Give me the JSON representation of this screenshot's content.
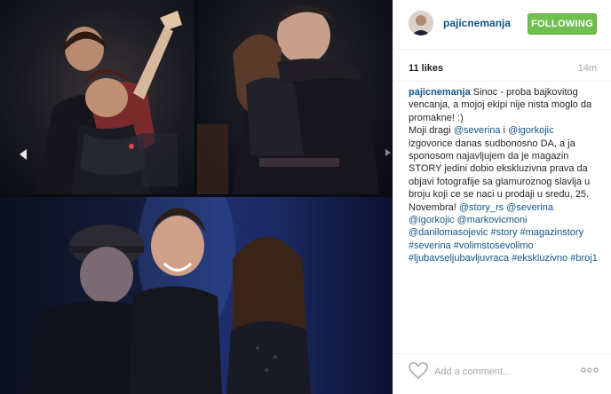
{
  "post": {
    "username": "pajicnemanja",
    "follow_label": "FOLLOWING",
    "likes": "11 likes",
    "time": "14m"
  },
  "caption": [
    {
      "t": "u",
      "v": "pajicnemanja"
    },
    {
      "t": "s",
      "v": " Sinoc - proba bajkovitog vencanja, a mojoj ekipi nije nista moglo da promakne! :)"
    },
    {
      "t": "br"
    },
    {
      "t": "s",
      "v": "Moji dragi "
    },
    {
      "t": "l",
      "v": "@severina"
    },
    {
      "t": "s",
      "v": " i "
    },
    {
      "t": "l",
      "v": "@igorkojic"
    },
    {
      "t": "s",
      "v": " izgovorice danas sudbonosno DA, a ja sponosom najavljujem da je magazin STORY jedini dobio ekskluzivna prava da objavi fotografije sa glamuroznog slavlja u broju koji ce se naci u prodaji u sredu, 25. Novembra! "
    },
    {
      "t": "l",
      "v": "@story_rs"
    },
    {
      "t": "s",
      "v": " "
    },
    {
      "t": "l",
      "v": "@severina"
    },
    {
      "t": "s",
      "v": " "
    },
    {
      "t": "l",
      "v": "@igorkojic"
    },
    {
      "t": "s",
      "v": " "
    },
    {
      "t": "l",
      "v": "@markovicmoni"
    },
    {
      "t": "s",
      "v": " "
    },
    {
      "t": "l",
      "v": "@danilomasojevic"
    },
    {
      "t": "s",
      "v": " "
    },
    {
      "t": "l",
      "v": "#story"
    },
    {
      "t": "s",
      "v": " "
    },
    {
      "t": "l",
      "v": "#magazinstory"
    },
    {
      "t": "s",
      "v": " "
    },
    {
      "t": "l",
      "v": "#severina"
    },
    {
      "t": "s",
      "v": " "
    },
    {
      "t": "l",
      "v": "#volimstosevolimo"
    },
    {
      "t": "s",
      "v": " "
    },
    {
      "t": "l",
      "v": "#ljubavseljubavljuvraca"
    },
    {
      "t": "s",
      "v": " "
    },
    {
      "t": "l",
      "v": "#ekskluzivno"
    },
    {
      "t": "s",
      "v": " "
    },
    {
      "t": "l",
      "v": "#broj1"
    }
  ],
  "comment": {
    "placeholder": "Add a comment..."
  },
  "icons": {
    "heart": "heart-outline-icon",
    "more": "more-options-icon",
    "prev": "prev-arrow-icon"
  },
  "colors": {
    "link": "#125688",
    "follow_bg": "#70c050",
    "muted": "#a5a7aa",
    "text": "#262626"
  }
}
